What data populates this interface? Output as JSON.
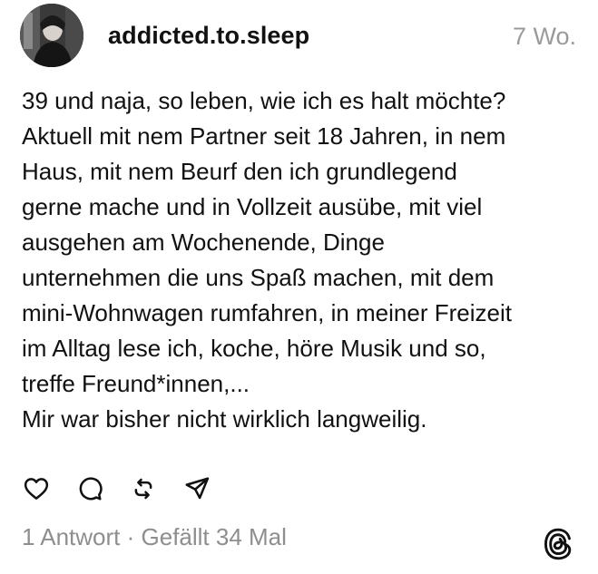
{
  "post": {
    "author": "addicted.to.sleep",
    "time_ago": "7 Wo.",
    "avatar_icon": "profile-photo",
    "body_lines": [
      "39 und naja, so leben, wie ich es halt möchte?",
      "Aktuell mit nem Partner seit 18 Jahren, in nem",
      "Haus, mit nem Beurf den ich grundlegend",
      "gerne mache und in Vollzeit ausübe, mit viel",
      "ausgehen am Wochenende, Dinge",
      "unternehmen die uns Spaß machen, mit dem",
      "mini-Wohnwagen rumfahren, in meiner Freizeit",
      "im Alltag lese ich, koche, höre Musik und so,",
      "treffe Freund*innen,...",
      "Mir war bisher nicht wirklich langweilig."
    ]
  },
  "actions": {
    "like_icon": "heart-icon",
    "comment_icon": "comment-icon",
    "repost_icon": "repost-icon",
    "share_icon": "send-icon"
  },
  "footer": {
    "replies": "1 Antwort",
    "separator": " · ",
    "likes": "Gefällt 34 Mal"
  },
  "brand": {
    "logo_icon": "threads-logo-icon",
    "text_color": "#111111",
    "muted_color": "#8e8e8e"
  }
}
